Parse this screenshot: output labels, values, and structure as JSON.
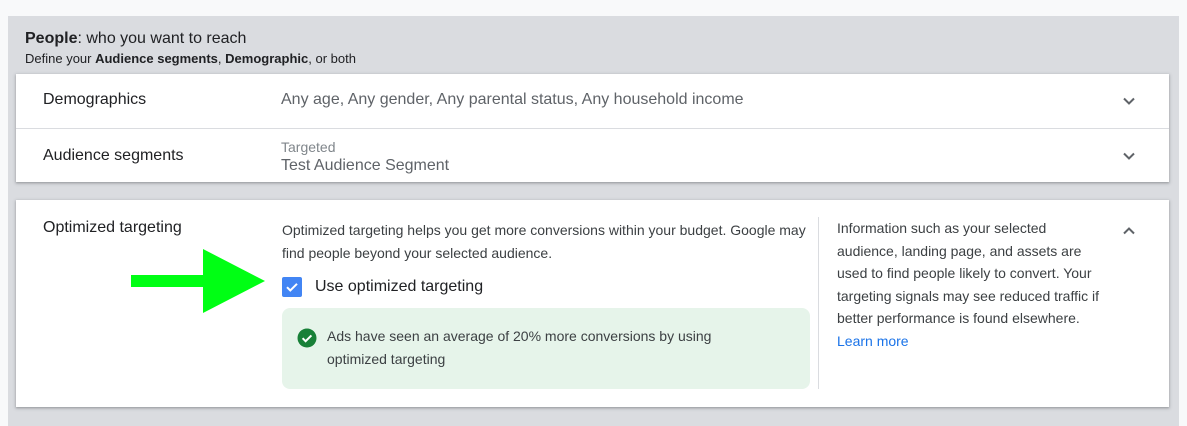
{
  "section": {
    "title_bold": "People",
    "title_rest": ": who you want to reach",
    "subtitle_prefix": "Define your ",
    "subtitle_bold1": "Audience segments",
    "subtitle_sep": ", ",
    "subtitle_bold2": "Demographic",
    "subtitle_suffix": ", or both"
  },
  "demographics": {
    "label": "Demographics",
    "value": "Any age, Any gender, Any parental status, Any household income"
  },
  "audience_segments": {
    "label": "Audience segments",
    "caption": "Targeted",
    "value": "Test Audience Segment"
  },
  "optimized_targeting": {
    "label": "Optimized targeting",
    "description": "Optimized targeting helps you get more conversions within your budget. Google may find people beyond your selected audience.",
    "checkbox_label": "Use optimized targeting",
    "checkbox_checked": true,
    "notice": "Ads have seen an average of 20% more conversions by using optimized targeting",
    "info_text": "Information such as your selected audience, landing page, and assets are used to find people likely to convert. Your targeting signals may see reduced traffic if better performance is found elsewhere.",
    "learn_more": "Learn more"
  },
  "colors": {
    "accent_blue": "#4285f4",
    "link_blue": "#1a73e8",
    "success_green": "#188038",
    "notice_bg": "#e6f4ea",
    "annotation_arrow": "#00ff14"
  },
  "icons": [
    "chevron-down-icon",
    "chevron-up-icon",
    "check-icon",
    "check-circle-icon",
    "annotation-arrow"
  ]
}
